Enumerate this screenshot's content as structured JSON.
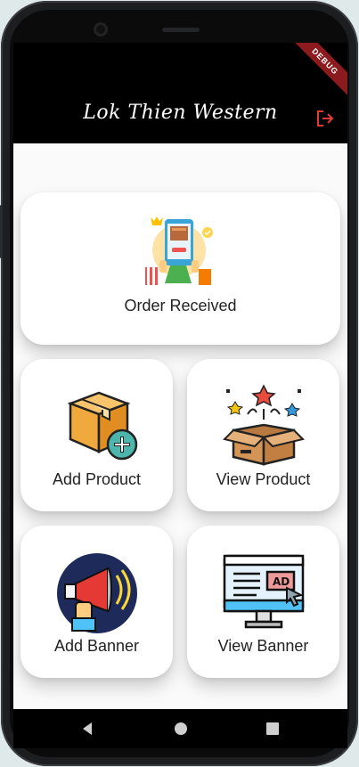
{
  "app": {
    "title": "Lok Thien Western",
    "debug_banner": "DEBUG"
  },
  "menu": [
    {
      "key": "order_received",
      "label": "Order Received"
    },
    {
      "key": "add_product",
      "label": "Add Product"
    },
    {
      "key": "view_product",
      "label": "View Product"
    },
    {
      "key": "add_banner",
      "label": "Add Banner"
    },
    {
      "key": "view_banner",
      "label": "View Banner"
    }
  ],
  "icons": {
    "logout": "logout-icon",
    "order_received": "order-received-illustration",
    "add_product": "add-box-icon",
    "view_product": "open-box-fireworks-icon",
    "add_banner": "megaphone-icon",
    "view_banner": "ad-monitor-icon",
    "nav_back": "back-triangle-icon",
    "nav_home": "home-circle-icon",
    "nav_recents": "recents-square-icon"
  },
  "colors": {
    "appbar": "#000000",
    "accent_logout": "#e53935",
    "background": "#fafafa",
    "card": "#ffffff"
  }
}
